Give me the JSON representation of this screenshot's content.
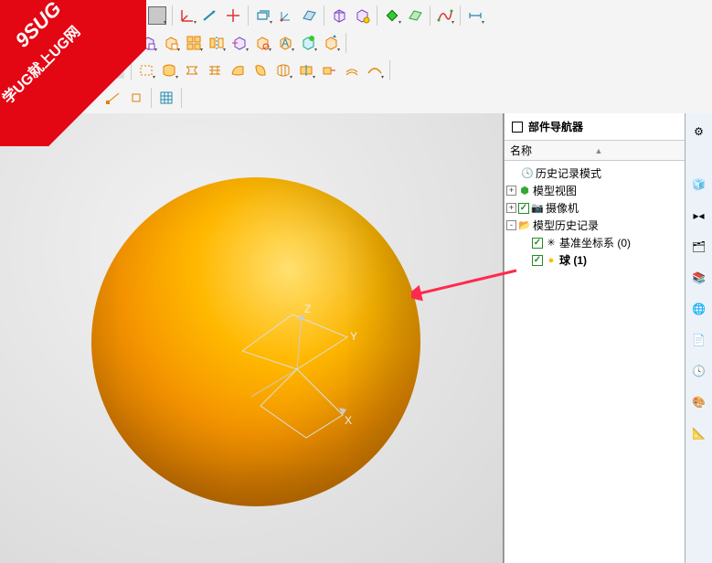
{
  "watermark": {
    "line1": "9SUG",
    "line2": "学UG就上UG网"
  },
  "panel": {
    "title": "部件导航器",
    "columns": {
      "name": "名称"
    },
    "tree": {
      "history_mode": "历史记录模式",
      "model_views": "模型视图",
      "cameras": "摄像机",
      "history": "模型历史记录",
      "datum_csys": "基准坐标系 (0)",
      "sphere": "球 (1)"
    }
  },
  "right_rail": {
    "settings": "⚙",
    "blocks": "🧊",
    "constraints": "▸◂",
    "layers": "🗂",
    "books": "📚",
    "web": "🌐",
    "page": "📄",
    "history_clock": "🕓",
    "palette": "🎨",
    "measure": "📐"
  },
  "swatch_color": "#c8c8c8"
}
